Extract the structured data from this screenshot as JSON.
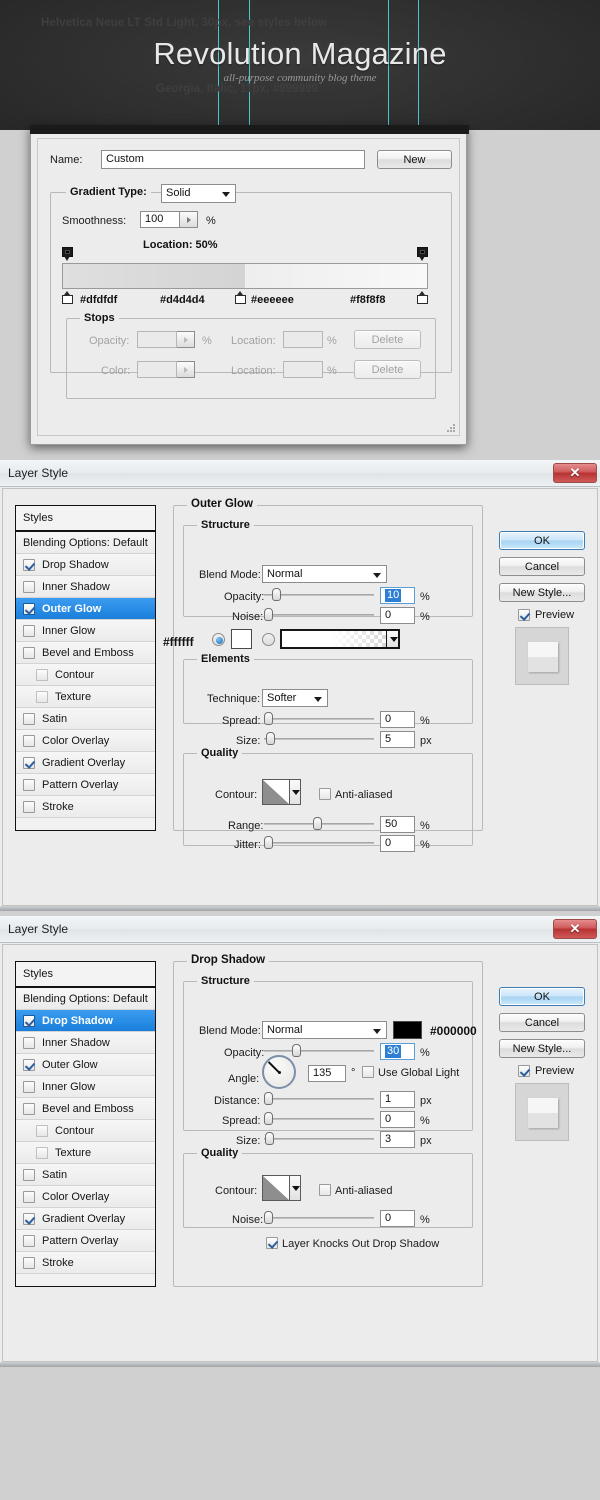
{
  "banner": {
    "note_top": "Helvetica Neue LT Std Light, 30px, see styles below",
    "site_title": "Revolution Magazine",
    "site_tagline": "all-purpose community blog theme",
    "note_bottom": "Georgia, Italic, 11px, #999999",
    "guide_color": "#4ee3e8",
    "tagline_color": "#999999"
  },
  "gradient_editor": {
    "name_label": "Name:",
    "name_value": "Custom",
    "new_button": "New",
    "gradient_type_label": "Gradient Type:",
    "gradient_type_value": "Solid",
    "smoothness_label": "Smoothness:",
    "smoothness_value": "100",
    "smoothness_unit": "%",
    "location_readout": "Location: 50%",
    "color_stops": [
      {
        "hex": "#dfdfdf",
        "location": 0
      },
      {
        "hex": "#d4d4d4",
        "location": 50
      },
      {
        "hex": "#eeeeee",
        "location": 50
      },
      {
        "hex": "#f8f8f8",
        "location": 100
      }
    ],
    "stops_group": "Stops",
    "opacity_label": "Opacity:",
    "opacity_value": "",
    "opacity_unit": "%",
    "location_label_1": "Location:",
    "location_value_1": "",
    "location_unit_1": "%",
    "delete_button_1": "Delete",
    "color_label": "Color:",
    "location_label_2": "Location:",
    "location_value_2": "",
    "location_unit_2": "%",
    "delete_button_2": "Delete"
  },
  "layer_style_outer_glow": {
    "window_title": "Layer Style",
    "close_label": "✕",
    "styles_header": "Styles",
    "styles_items": [
      {
        "label": "Blending Options: Default",
        "checked": null,
        "selected": false,
        "sub": false
      },
      {
        "label": "Drop Shadow",
        "checked": true,
        "selected": false,
        "sub": false
      },
      {
        "label": "Inner Shadow",
        "checked": false,
        "selected": false,
        "sub": false
      },
      {
        "label": "Outer Glow",
        "checked": true,
        "selected": true,
        "sub": false
      },
      {
        "label": "Inner Glow",
        "checked": false,
        "selected": false,
        "sub": false
      },
      {
        "label": "Bevel and Emboss",
        "checked": false,
        "selected": false,
        "sub": false
      },
      {
        "label": "Contour",
        "checked": false,
        "selected": false,
        "sub": true
      },
      {
        "label": "Texture",
        "checked": false,
        "selected": false,
        "sub": true
      },
      {
        "label": "Satin",
        "checked": false,
        "selected": false,
        "sub": false
      },
      {
        "label": "Color Overlay",
        "checked": false,
        "selected": false,
        "sub": false
      },
      {
        "label": "Gradient Overlay",
        "checked": true,
        "selected": false,
        "sub": false
      },
      {
        "label": "Pattern Overlay",
        "checked": false,
        "selected": false,
        "sub": false
      },
      {
        "label": "Stroke",
        "checked": false,
        "selected": false,
        "sub": false
      }
    ],
    "panel_title": "Outer Glow",
    "structure_group": "Structure",
    "blend_mode_label": "Blend Mode:",
    "blend_mode_value": "Normal",
    "opacity_label": "Opacity:",
    "opacity_value": "10",
    "opacity_unit": "%",
    "noise_label": "Noise:",
    "noise_value": "0",
    "noise_unit": "%",
    "glow_color_hex": "#ffffff",
    "elements_group": "Elements",
    "technique_label": "Technique:",
    "technique_value": "Softer",
    "spread_label": "Spread:",
    "spread_value": "0",
    "spread_unit": "%",
    "size_label": "Size:",
    "size_value": "5",
    "size_unit": "px",
    "quality_group": "Quality",
    "contour_label": "Contour:",
    "anti_aliased_label": "Anti-aliased",
    "anti_aliased_checked": false,
    "range_label": "Range:",
    "range_value": "50",
    "range_unit": "%",
    "jitter_label": "Jitter:",
    "jitter_value": "0",
    "jitter_unit": "%",
    "ok_button": "OK",
    "cancel_button": "Cancel",
    "new_style_button": "New Style...",
    "preview_label": "Preview",
    "preview_checked": true
  },
  "layer_style_drop_shadow": {
    "window_title": "Layer Style",
    "close_label": "✕",
    "styles_header": "Styles",
    "styles_items": [
      {
        "label": "Blending Options: Default",
        "checked": null,
        "selected": false,
        "sub": false
      },
      {
        "label": "Drop Shadow",
        "checked": true,
        "selected": true,
        "sub": false
      },
      {
        "label": "Inner Shadow",
        "checked": false,
        "selected": false,
        "sub": false
      },
      {
        "label": "Outer Glow",
        "checked": true,
        "selected": false,
        "sub": false
      },
      {
        "label": "Inner Glow",
        "checked": false,
        "selected": false,
        "sub": false
      },
      {
        "label": "Bevel and Emboss",
        "checked": false,
        "selected": false,
        "sub": false
      },
      {
        "label": "Contour",
        "checked": false,
        "selected": false,
        "sub": true
      },
      {
        "label": "Texture",
        "checked": false,
        "selected": false,
        "sub": true
      },
      {
        "label": "Satin",
        "checked": false,
        "selected": false,
        "sub": false
      },
      {
        "label": "Color Overlay",
        "checked": false,
        "selected": false,
        "sub": false
      },
      {
        "label": "Gradient Overlay",
        "checked": true,
        "selected": false,
        "sub": false
      },
      {
        "label": "Pattern Overlay",
        "checked": false,
        "selected": false,
        "sub": false
      },
      {
        "label": "Stroke",
        "checked": false,
        "selected": false,
        "sub": false
      }
    ],
    "panel_title": "Drop Shadow",
    "structure_group": "Structure",
    "blend_mode_label": "Blend Mode:",
    "blend_mode_value": "Normal",
    "shadow_color_hex": "#000000",
    "opacity_label": "Opacity:",
    "opacity_value": "30",
    "opacity_unit": "%",
    "angle_label": "Angle:",
    "angle_value": "135",
    "angle_unit": "°",
    "use_global_light_label": "Use Global Light",
    "use_global_light_checked": false,
    "distance_label": "Distance:",
    "distance_value": "1",
    "distance_unit": "px",
    "spread_label": "Spread:",
    "spread_value": "0",
    "spread_unit": "%",
    "size_label": "Size:",
    "size_value": "3",
    "size_unit": "px",
    "quality_group": "Quality",
    "contour_label": "Contour:",
    "anti_aliased_label": "Anti-aliased",
    "anti_aliased_checked": false,
    "noise_label": "Noise:",
    "noise_value": "0",
    "noise_unit": "%",
    "knockout_label": "Layer Knocks Out Drop Shadow",
    "knockout_checked": true,
    "ok_button": "OK",
    "cancel_button": "Cancel",
    "new_style_button": "New Style...",
    "preview_label": "Preview",
    "preview_checked": true
  }
}
